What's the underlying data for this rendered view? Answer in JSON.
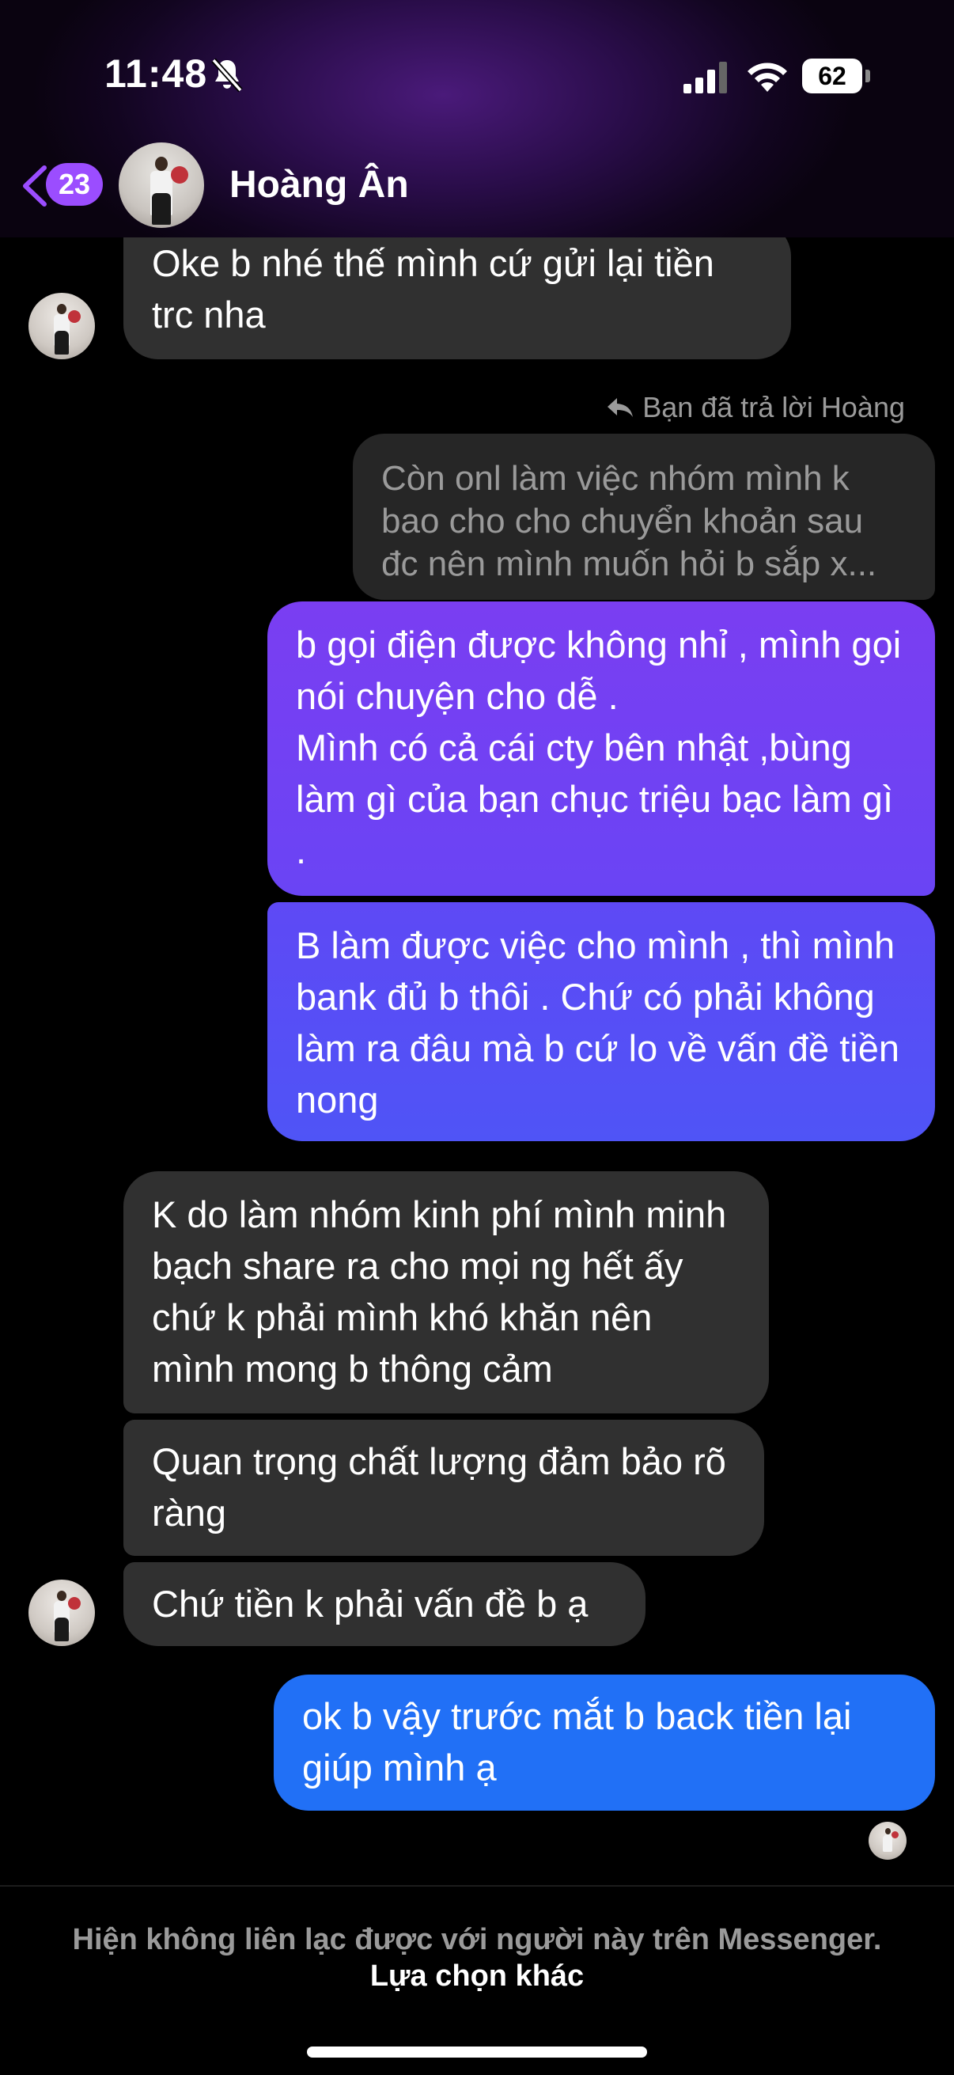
{
  "status_bar": {
    "time": "11:48",
    "battery": "62"
  },
  "header": {
    "back_badge": "23",
    "contact_name": "Hoàng Ân"
  },
  "messages": {
    "m1": "Oke b nhé thế mình cứ gửi lại tiền trc nha",
    "reply_label": "Bạn đã trả lời Hoàng",
    "quoted": "Còn onl làm việc nhóm mình k bao cho cho chuyển khoản sau đc nên mình muốn hỏi b sắp x...",
    "m2_line1": "b gọi điện được không nhỉ , mình gọi nói chuyện cho dễ .",
    "m2_line2": "Mình có cả cái cty bên nhật ,bùng làm gì của bạn chục triệu bạc làm gì .",
    "m3": "B làm được việc cho mình , thì mình bank đủ b thôi . Chứ có phải không làm ra đâu mà b cứ lo về vấn đề tiền nong",
    "m4": "K do làm nhóm kinh phí mình minh bạch share ra cho mọi ng hết ấy chứ k phải mình khó khăn nên mình mong b thông cảm",
    "m5": "Quan trọng chất lượng đảm bảo rõ ràng",
    "m6": "Chứ tiền k phải vấn đề b ạ",
    "m7": "ok b vậy trước mắt b back tiền lại giúp mình ạ"
  },
  "footer": {
    "notice": "Hiện không liên lạc được với người này trên Messenger.",
    "link": "Lựa chọn khác"
  },
  "colors": {
    "outgoing_gradient_top": "#7b3ff2",
    "outgoing_gradient_mid": "#5a4cf6",
    "outgoing_blue": "#1f6ef7",
    "incoming": "#303030",
    "badge": "#9b4dff"
  }
}
